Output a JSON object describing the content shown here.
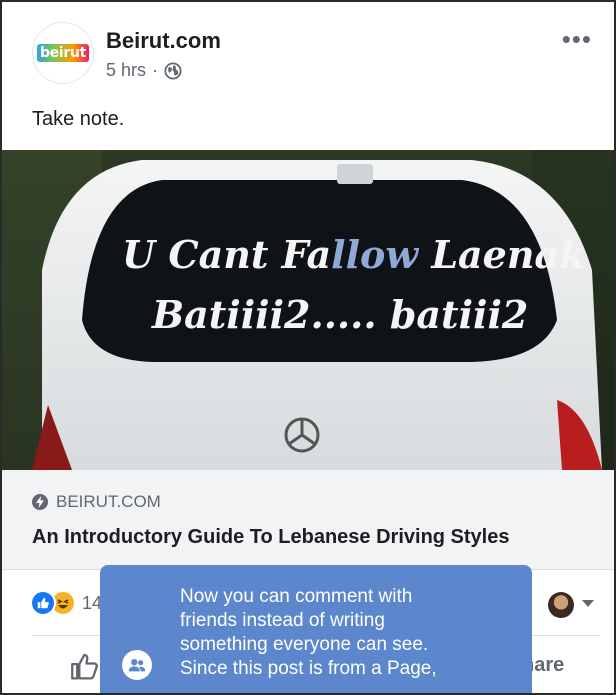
{
  "post": {
    "page_name": "Beirut.com",
    "avatar_text": "beirut",
    "time": "5 hrs",
    "separator": "·",
    "privacy_icon": "globe-icon",
    "more_icon": "more-options-icon",
    "caption": "Take note."
  },
  "image": {
    "alt": "Rear window of a white van with text",
    "line1_part1": "U Cant Fa",
    "line1_part2": "llow",
    "line1_part3": " Laenak",
    "line2": "Batiiii2..... batiii2"
  },
  "link_preview": {
    "domain": "BEIRUT.COM",
    "title": "An Introductory Guide To Lebanese Driving Styles"
  },
  "reactions": {
    "types": [
      "like",
      "haha"
    ],
    "count": "14"
  },
  "actions": {
    "share_label": "hare"
  },
  "tooltip": {
    "lines": [
      "Now you can comment with",
      "friends instead of writing",
      "something everyone can see.",
      "Since this post is from a Page,"
    ],
    "icon": "group-icon"
  },
  "colors": {
    "tooltip_bg": "#5c87cc",
    "like_blue": "#1877f2",
    "haha_yellow": "#f7b125",
    "secondary_text": "#606770"
  }
}
